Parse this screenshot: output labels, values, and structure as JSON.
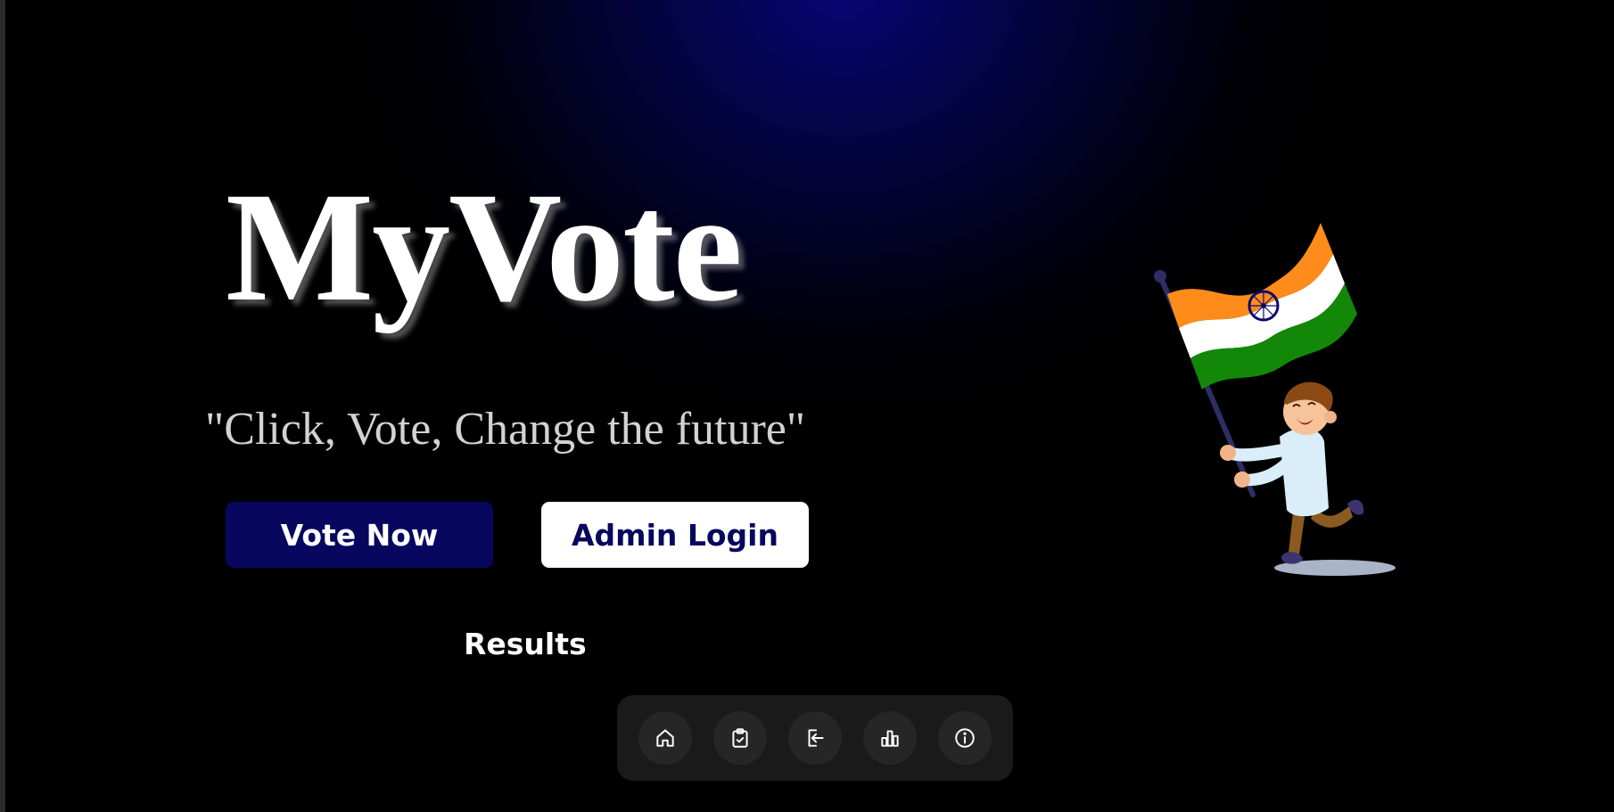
{
  "app": {
    "title": "MyVote",
    "tagline": "\"Click, Vote, Change the future\""
  },
  "actions": {
    "vote_now_label": "Vote Now",
    "admin_login_label": "Admin Login",
    "results_label": "Results"
  },
  "dock": {
    "items": [
      {
        "icon": "home-icon"
      },
      {
        "icon": "clipboard-check-icon"
      },
      {
        "icon": "login-icon"
      },
      {
        "icon": "bar-chart-icon"
      },
      {
        "icon": "info-icon"
      }
    ]
  },
  "colors": {
    "background": "#000000",
    "glow": "#060676",
    "primary_button": "#07075f",
    "secondary_button": "#ffffff",
    "dock_background": "#1a1a1a",
    "dock_button": "#262626",
    "flag_saffron": "#ff8c1a",
    "flag_white": "#ffffff",
    "flag_green": "#138808",
    "flag_chakra": "#0a0a6e"
  },
  "illustration": {
    "icon": "boy-waving-indian-flag-illustration"
  }
}
